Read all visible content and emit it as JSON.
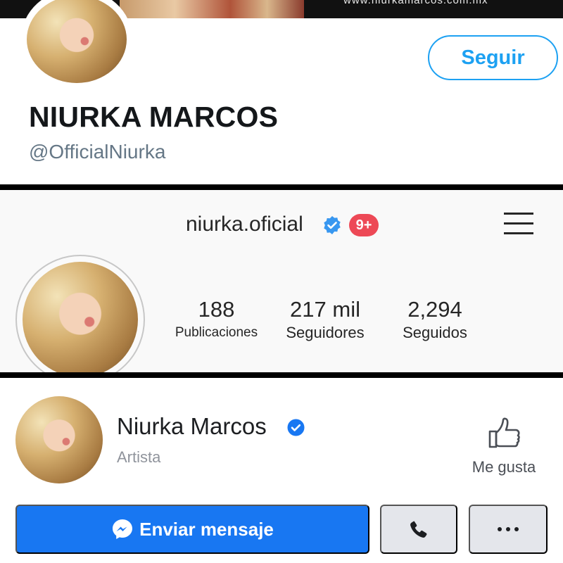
{
  "twitter": {
    "banner_url": "www.niurkamarcos.com.mx",
    "follow_label": "Seguir",
    "display_name": "NIURKA MARCOS",
    "handle": "@OfficialNiurka"
  },
  "instagram": {
    "username": "niurka.oficial",
    "notification_badge": "9+",
    "stats": [
      {
        "value": "188",
        "label": "Publicaciones"
      },
      {
        "value": "217 mil",
        "label": "Seguidores"
      },
      {
        "value": "2,294",
        "label": "Seguidos"
      }
    ]
  },
  "facebook": {
    "page_name": "Niurka Marcos",
    "category": "Artista",
    "like_label": "Me gusta",
    "message_label": "Enviar mensaje"
  },
  "colors": {
    "twitter_blue": "#1da1f2",
    "instagram_badge_red": "#ed4956",
    "instagram_verified_blue": "#3897f0",
    "facebook_blue": "#1877f2",
    "facebook_gray_button": "#e4e6eb",
    "divider": "#000000"
  },
  "icons": {
    "verified": "verified-badge-icon",
    "menu": "hamburger-menu-icon",
    "like": "thumbs-up-icon",
    "messenger": "messenger-icon",
    "call": "phone-icon",
    "more": "more-dots-icon"
  }
}
